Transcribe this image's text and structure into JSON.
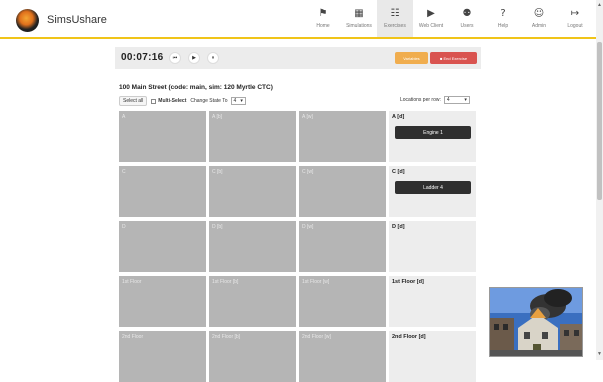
{
  "app": {
    "brand": "SimsUshare"
  },
  "nav": [
    {
      "label": "Home",
      "icon": "⚑",
      "icon_name": "home-icon",
      "active": false
    },
    {
      "label": "Simulations",
      "icon": "▦",
      "icon_name": "map-icon",
      "active": false
    },
    {
      "label": "Exercises",
      "icon": "☷",
      "icon_name": "sitemap-icon",
      "active": true
    },
    {
      "label": "Web Client",
      "icon": "▶",
      "icon_name": "play-icon",
      "active": false
    },
    {
      "label": "Users",
      "icon": "⚉",
      "icon_name": "users-icon",
      "active": false
    },
    {
      "label": "Help",
      "icon": "?",
      "icon_name": "help-icon",
      "active": false
    },
    {
      "label": "Admin",
      "icon": "☺",
      "icon_name": "user-circle-icon",
      "active": false
    },
    {
      "label": "Logout",
      "icon": "↦",
      "icon_name": "logout-icon",
      "active": false
    }
  ],
  "timer": {
    "time": "00:07:16",
    "controls": [
      "⏮",
      "▶",
      "⏸"
    ],
    "variables_label": "Variables",
    "end_label": "■ End Exercise"
  },
  "scene": {
    "title": "100 Main Street (code: main, sim: 120 Myrtle CTC)",
    "select_all": "Select all",
    "multi_select": "Multi-Select",
    "change_state": "Change State To",
    "change_state_value": "4",
    "locations_label": "Locations per row:",
    "locations_value": "4"
  },
  "grid": {
    "rows": [
      [
        "A",
        "A [b]",
        "A [w]",
        "A [d]"
      ],
      [
        "C",
        "C [b]",
        "C [w]",
        "C [d]"
      ],
      [
        "D",
        "D [b]",
        "D [w]",
        "D [d]"
      ],
      [
        "1st Floor",
        "1st Floor [b]",
        "1st Floor [w]",
        "1st Floor [d]"
      ],
      [
        "2nd Floor",
        "2nd Floor [b]",
        "2nd Floor [w]",
        "2nd Floor [d]"
      ]
    ],
    "units": {
      "0": "Engine 1",
      "1": "Ladder 4"
    }
  },
  "colors": {
    "accent": "#f0c419",
    "variables": "#f0ad4e",
    "end": "#d9534f"
  }
}
